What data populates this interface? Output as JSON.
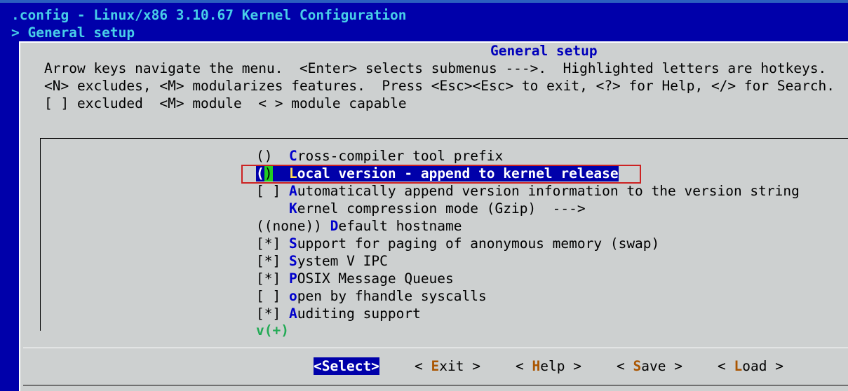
{
  "window": {
    "title": ".config - Linux/x86 3.10.67 Kernel Configuration",
    "breadcrumb": "> General setup"
  },
  "dialog": {
    "title": "General setup",
    "help_lines": [
      "Arrow keys navigate the menu.  <Enter> selects submenus --->.  Highlighted letters are hotkeys.",
      "<N> excludes, <M> modularizes features.  Press <Esc><Esc> to exit, <?> for Help, </> for Search.",
      "[ ] excluded  <M> module  < > module capable"
    ]
  },
  "menu": {
    "items": [
      {
        "prefix": "()  ",
        "hotkey": "C",
        "rest": "ross-compiler tool prefix"
      },
      {
        "prefix_open": "(",
        "cursor": ")",
        "gap": "  ",
        "hotkey": "L",
        "rest": "ocal version - append to kernel release",
        "selected": true
      },
      {
        "prefix": "[ ] ",
        "hotkey": "A",
        "rest": "utomatically append version information to the version string"
      },
      {
        "prefix": "    ",
        "hotkey": "K",
        "rest": "ernel compression mode (Gzip)  --->"
      },
      {
        "prefix": "((none)) ",
        "hotkey": "D",
        "rest": "efault hostname"
      },
      {
        "prefix": "[*] ",
        "hotkey": "S",
        "rest": "upport for paging of anonymous memory (swap)"
      },
      {
        "prefix": "[*] ",
        "hotkey": "S",
        "rest": "ystem V IPC"
      },
      {
        "prefix": "[*] ",
        "hotkey": "P",
        "rest": "OSIX Message Queues"
      },
      {
        "prefix": "[ ] ",
        "hotkey": "o",
        "rest": "pen by fhandle syscalls"
      },
      {
        "prefix": "[*] ",
        "hotkey": "A",
        "rest": "uditing support"
      }
    ],
    "more_indicator": "v(+)"
  },
  "buttons": {
    "select": "<Select>",
    "exit": {
      "open": "< ",
      "hotkey": "E",
      "rest": "xit",
      "close": " >"
    },
    "help": {
      "open": "< ",
      "hotkey": "H",
      "rest": "elp",
      "close": " >"
    },
    "save": {
      "open": "< ",
      "hotkey": "S",
      "rest": "ave",
      "close": " >"
    },
    "load": {
      "open": "< ",
      "hotkey": "L",
      "rest": "oad",
      "close": " >"
    }
  },
  "colors": {
    "background": "#0000aa",
    "dialog": "#cdd0d0",
    "title_text": "#48cfe8",
    "hotkey": "#0000cc",
    "selection": "#0000aa",
    "cursor": "#22cc22",
    "annotation": "#cc2222"
  }
}
